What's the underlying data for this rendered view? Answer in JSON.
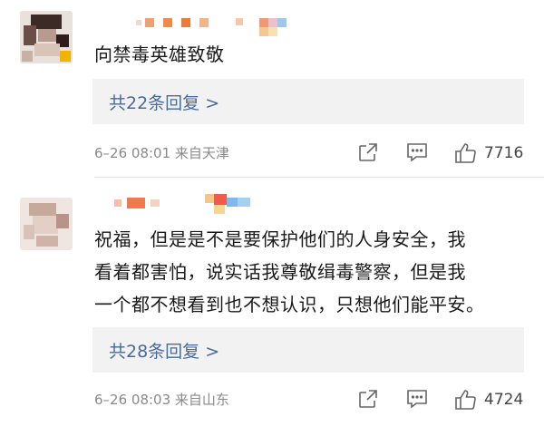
{
  "comments": [
    {
      "text_lines": [
        "向禁毒英雄致敬"
      ],
      "replies_label": "共22条回复 >",
      "meta": "6–26 08:01 来自天津",
      "likes": "7716"
    },
    {
      "text_lines": [
        "祝福，但是是不是要保护他们的人身安全，我",
        "看着都害怕，说实话我尊敬缉毒警察，但是我",
        "一个都不想看到也不想认识，只想他们能平安。"
      ],
      "replies_label": "共28条回复 >",
      "meta": "6–26 08:03 来自山东",
      "likes": "4724"
    }
  ],
  "colors": {
    "link": "#4a6a9a",
    "meta": "#8a8a8a",
    "reply_box": "#f2f2f2"
  },
  "icons": {
    "share": "share-icon",
    "reply": "comment-icon",
    "like": "thumbs-up-icon"
  }
}
